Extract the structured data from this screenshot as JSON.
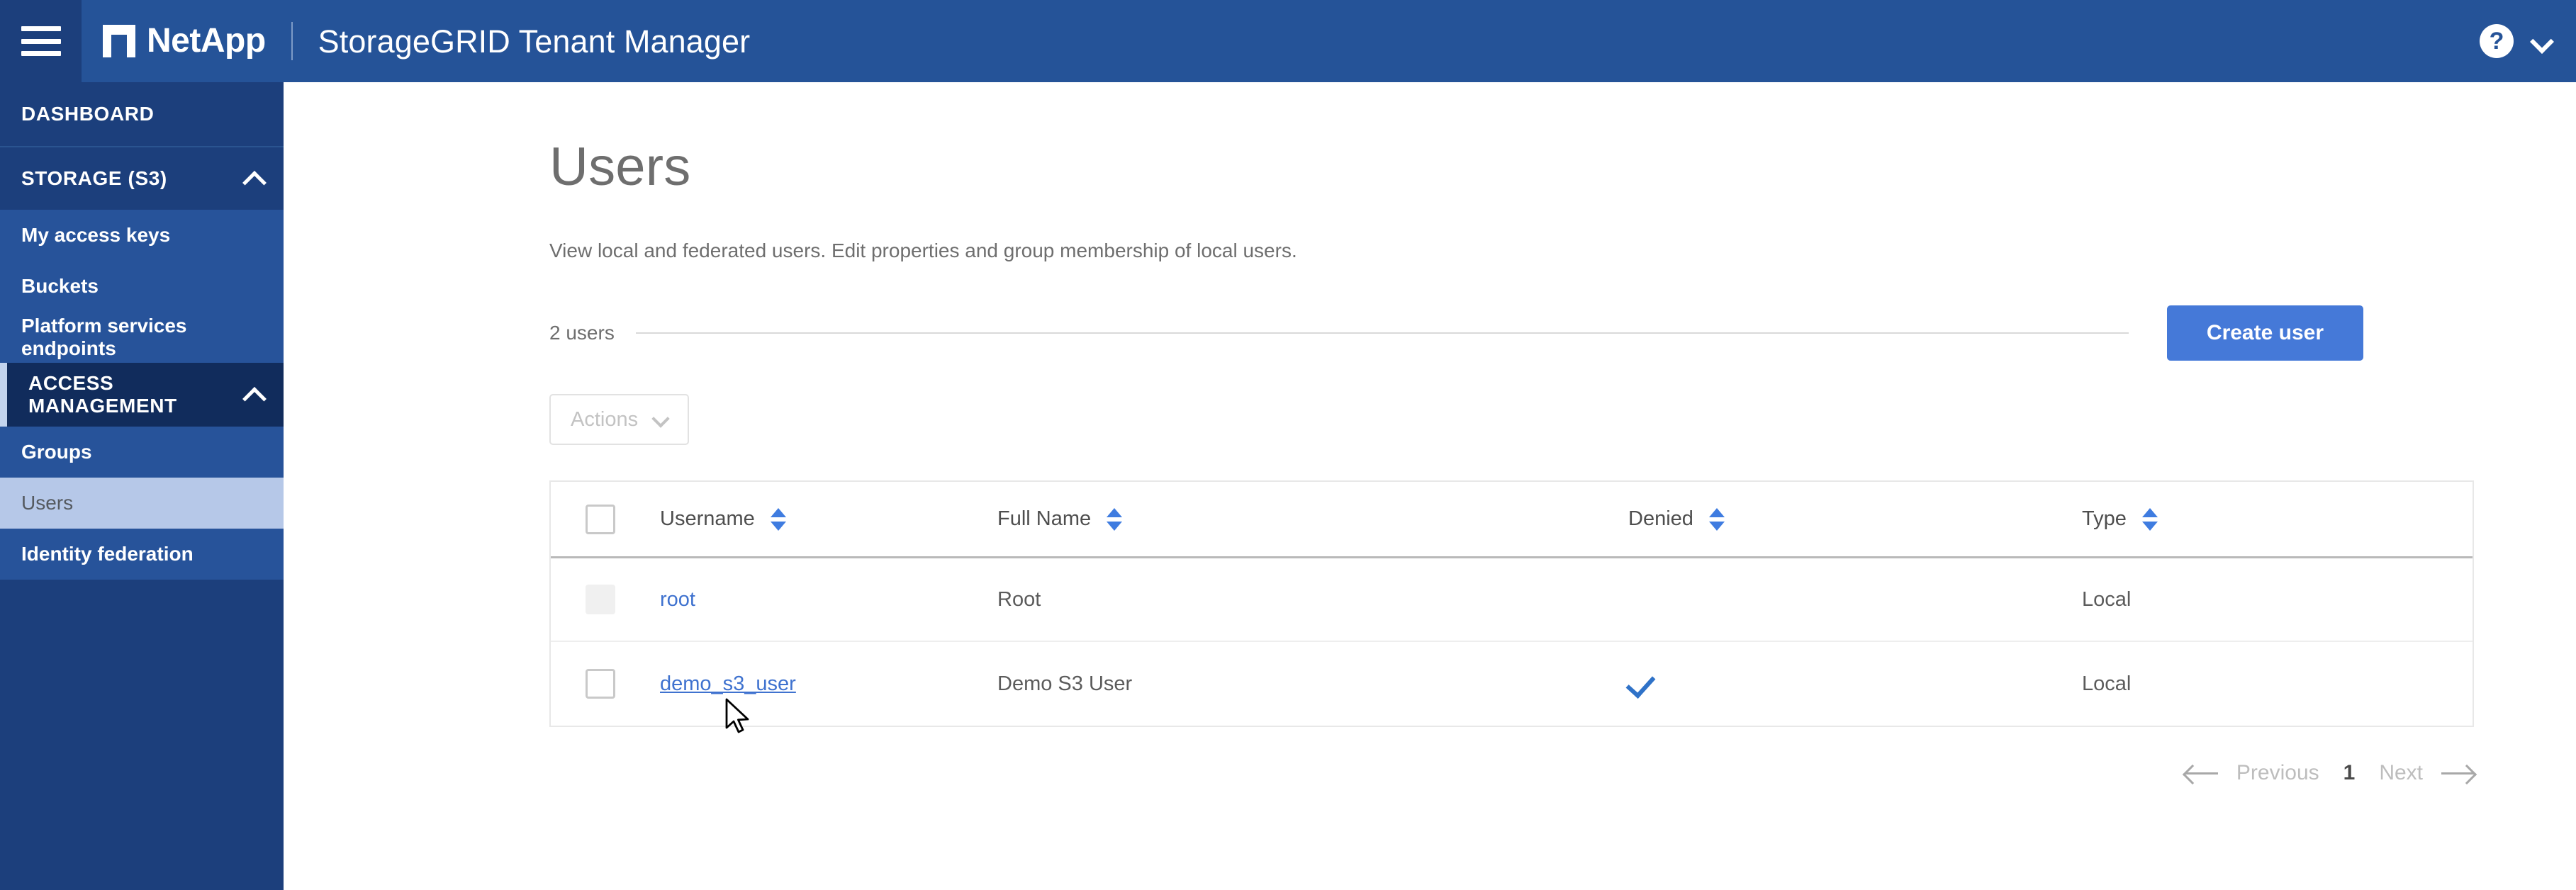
{
  "header": {
    "menu_icon": "hamburger-icon",
    "brand": "NetApp",
    "app_title": "StorageGRID Tenant Manager",
    "help_icon": "?",
    "account_chevron": "chevron-down-icon",
    "bar_color": "#255398",
    "menu_zone_color": "#1c3f7c"
  },
  "sidebar": {
    "background": "#1c3f7c",
    "selected_background": "#b6c8e8",
    "dashboard": {
      "label": "DASHBOARD"
    },
    "sections": [
      {
        "label": "STORAGE (S3)",
        "expanded": true,
        "chevron": "chevron-up-icon",
        "items": [
          {
            "label": "My access keys",
            "selected": false
          },
          {
            "label": "Buckets",
            "selected": false
          },
          {
            "label": "Platform services endpoints",
            "selected": false
          }
        ]
      },
      {
        "label": "ACCESS MANAGEMENT",
        "expanded": true,
        "chevron": "chevron-up-icon",
        "items": [
          {
            "label": "Groups",
            "selected": false
          },
          {
            "label": "Users",
            "selected": true
          },
          {
            "label": "Identity federation",
            "selected": false
          }
        ]
      }
    ]
  },
  "main": {
    "title": "Users",
    "description": "View local and federated users. Edit properties and group membership of local users.",
    "count_label": "2 users",
    "create_button": "Create user",
    "actions_button": "Actions",
    "actions_enabled": false,
    "accent_color": "#4579d8",
    "link_color": "#3f72cf"
  },
  "table": {
    "columns": [
      {
        "key": "username",
        "label": "Username",
        "sortable": true
      },
      {
        "key": "fullname",
        "label": "Full Name",
        "sortable": true
      },
      {
        "key": "denied",
        "label": "Denied",
        "sortable": true
      },
      {
        "key": "type",
        "label": "Type",
        "sortable": true
      }
    ],
    "header_checkbox_state": "unchecked",
    "rows": [
      {
        "checkbox_state": "disabled",
        "username": "root",
        "fullname": "Root",
        "denied": "",
        "type": "Local",
        "hovered": false
      },
      {
        "checkbox_state": "unchecked",
        "username": "demo_s3_user",
        "fullname": "Demo S3 User",
        "denied": "check-icon",
        "type": "Local",
        "hovered": true
      }
    ]
  },
  "pagination": {
    "previous_label": "Previous",
    "current_page": "1",
    "next_label": "Next",
    "previous_enabled": false,
    "next_enabled": false
  }
}
